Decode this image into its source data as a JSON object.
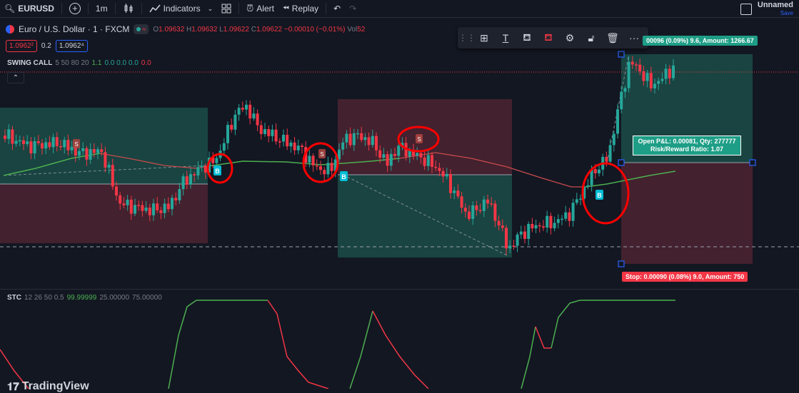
{
  "toolbar": {
    "symbol": "EURUSD",
    "interval": "1m",
    "indicators_label": "Indicators",
    "alert_label": "Alert",
    "replay_label": "Replay",
    "layout_name": "Unnamed",
    "layout_save": "Save"
  },
  "legend": {
    "title": "Euro / U.S. Dollar · 1 · FXCM",
    "open_label": "O",
    "open": "1.09632",
    "high_label": "H",
    "high": "1.09632",
    "low_label": "L",
    "low": "1.09622",
    "close_label": "C",
    "close": "1.09622",
    "change": "−0.00010 (−0.01%)",
    "vol_label": "Vol",
    "vol": "52",
    "bid": "1.0962²",
    "spread": "0.2",
    "ask": "1.0962⁴"
  },
  "indicators": {
    "swing_name": "SWING CALL",
    "swing_params": "5 50 80 20",
    "swing_v1": "1.1",
    "swing_v2": "0.0 0.0 0.0",
    "swing_v3": "0.0",
    "stc_name": "STC",
    "stc_params": "12 26 50 0.5",
    "stc_v1": "99.99999",
    "stc_v2": "25.00000",
    "stc_v3": "75.00000"
  },
  "position": {
    "target_label": "00096 (0.09%) 9.6, Amount: 1266.67",
    "pnl_line1": "Open P&L: 0.00081, Qty: 277777",
    "pnl_line2": "Risk/Reward Ratio: 1.07",
    "stop_label": "Stop: 0.00090 (0.08%) 9.0, Amount: 750"
  },
  "signals": {
    "buy": "B",
    "sell": "S"
  },
  "branding": {
    "logo": "TradingView"
  },
  "colors": {
    "bull": "#26a69a",
    "bear": "#f23645",
    "ema": "#4caf50",
    "profit_zone": "#1b4c47",
    "loss_zone": "#4c2330",
    "annotation": "#ff0000"
  }
}
